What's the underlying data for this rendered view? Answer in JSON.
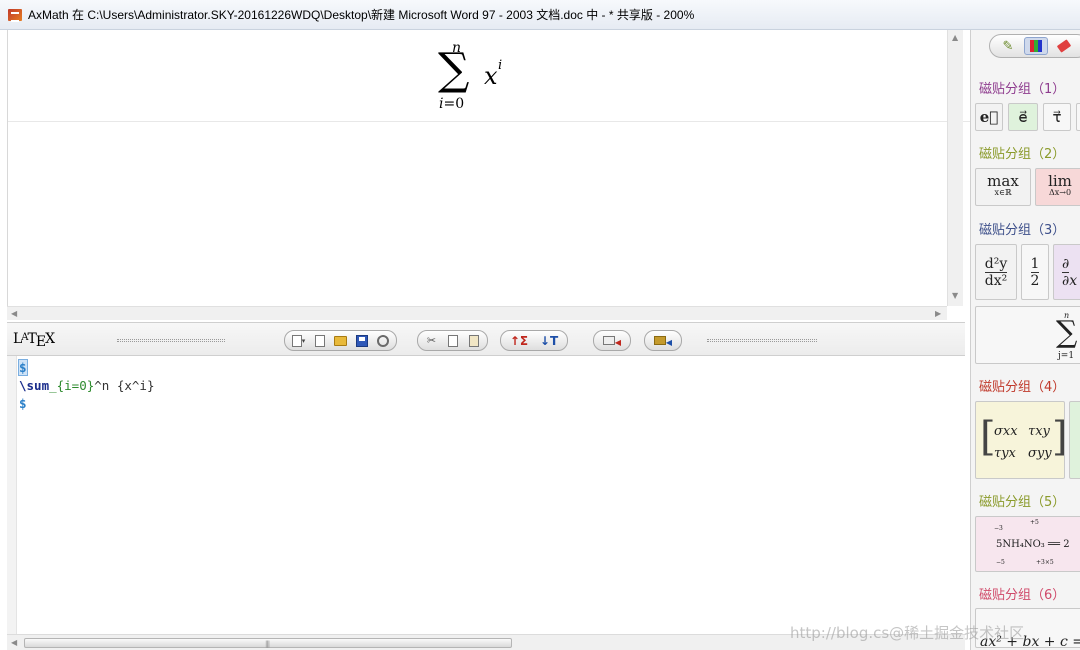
{
  "window": {
    "title": "AxMath 在 C:\\Users\\Administrator.SKY-20161226WDQ\\Desktop\\新建 Microsoft Word 97 - 2003 文档.doc 中 - * 共享版 - 200%"
  },
  "preview": {
    "upper_limit": "n",
    "sum_symbol": "∑",
    "base": "x",
    "exponent": "i",
    "lower_var": "i",
    "lower_eq": "=0"
  },
  "latex_toolbar": {
    "logo": "LATEX",
    "buttons": [
      {
        "name": "document-menu",
        "icon": "doc-menu-icon"
      },
      {
        "name": "new",
        "icon": "new-doc-icon"
      },
      {
        "name": "open",
        "icon": "folder-icon"
      },
      {
        "name": "save",
        "icon": "save-icon"
      },
      {
        "name": "settings",
        "icon": "gear-icon"
      },
      {
        "name": "cut",
        "icon": "scissors-icon"
      },
      {
        "name": "copy",
        "icon": "copy-icon"
      },
      {
        "name": "paste",
        "icon": "paste-icon"
      },
      {
        "name": "to-formula",
        "icon": "sigma-up-icon"
      },
      {
        "name": "to-latex",
        "icon": "t-down-icon"
      },
      {
        "name": "export",
        "icon": "export-icon"
      },
      {
        "name": "toolbox",
        "icon": "toolbox-icon"
      }
    ]
  },
  "editor": {
    "line1": "$",
    "line2_cmd": "\\sum",
    "line2_sub": "_{i=0}",
    "line2_sup": "^n",
    "line2_arg": " {x^i}",
    "line3": "$"
  },
  "panel": {
    "groups": [
      {
        "title": "磁贴分组（1）",
        "color": "#8e3b8e"
      },
      {
        "title": "磁贴分组（2）",
        "color": "#8a9a2a"
      },
      {
        "title": "磁贴分组（3）",
        "color": "#3d4f8a"
      },
      {
        "title": "磁贴分组（4）",
        "color": "#c0392b"
      },
      {
        "title": "磁贴分组（5）",
        "color": "#8a9a2a"
      },
      {
        "title": "磁贴分组（6）",
        "color": "#d04a6a"
      }
    ],
    "tiles": {
      "g1": [
        "e⃗",
        "e⃗",
        "τ⃗"
      ],
      "g2": [
        "max",
        "x∈ℝ",
        "lim",
        "Δx→0"
      ],
      "g3": [
        "d²y",
        "dx²",
        "1",
        "2",
        "∂",
        "∂x",
        "∑",
        "j=1",
        "n"
      ],
      "g4": [
        "σxx",
        "τxy",
        "τyx",
        "σyy"
      ],
      "g5": [
        "−3",
        "+5",
        "5NH₄NO₃ ══ 2",
        "+3×5",
        "−5"
      ],
      "g6": [
        "ax² + bx + c ="
      ]
    }
  },
  "watermark": "http://blog.cs@稀土掘金技术社区",
  "colors": {
    "group1": "#8e3b8e",
    "group2": "#8a9a2a",
    "group3": "#3d4f8a",
    "group4": "#c0392b",
    "group5": "#8a9a2a",
    "group6": "#d04a6a"
  }
}
